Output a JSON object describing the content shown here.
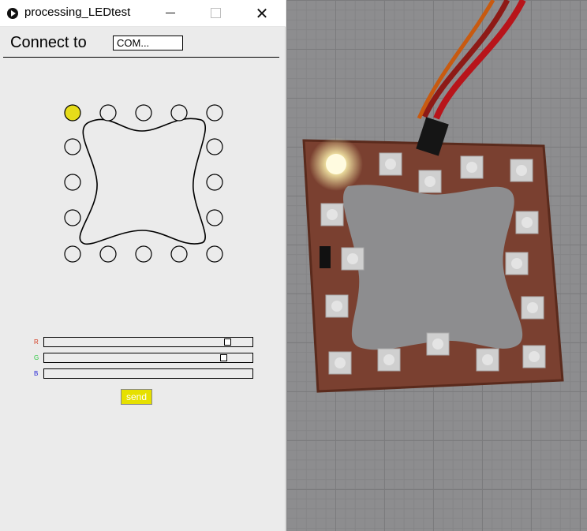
{
  "window": {
    "title": "processing_LEDtest",
    "controls": {
      "minimize_icon": "minimize-icon",
      "maximize_icon": "maximize-icon",
      "close_glyph": "✕"
    }
  },
  "connection": {
    "label": "Connect to",
    "port_value": "COM..."
  },
  "led_ring": {
    "count": 16,
    "active_index": 0,
    "active_color": "#e6dc1a",
    "inactive_color": "#ebebeb"
  },
  "sliders": [
    {
      "letter": "R",
      "color": "#d43a1e",
      "value": 0.88
    },
    {
      "letter": "G",
      "color": "#26c83a",
      "value": 0.86
    },
    {
      "letter": "B",
      "color": "#1e1ed4",
      "value": null
    }
  ],
  "send_button": {
    "label": "send",
    "color": "#e6e000"
  },
  "photo": {
    "subject": "led-board-photo",
    "board_color": "#8a4a30",
    "lit_led_color": "#fffbe0"
  }
}
